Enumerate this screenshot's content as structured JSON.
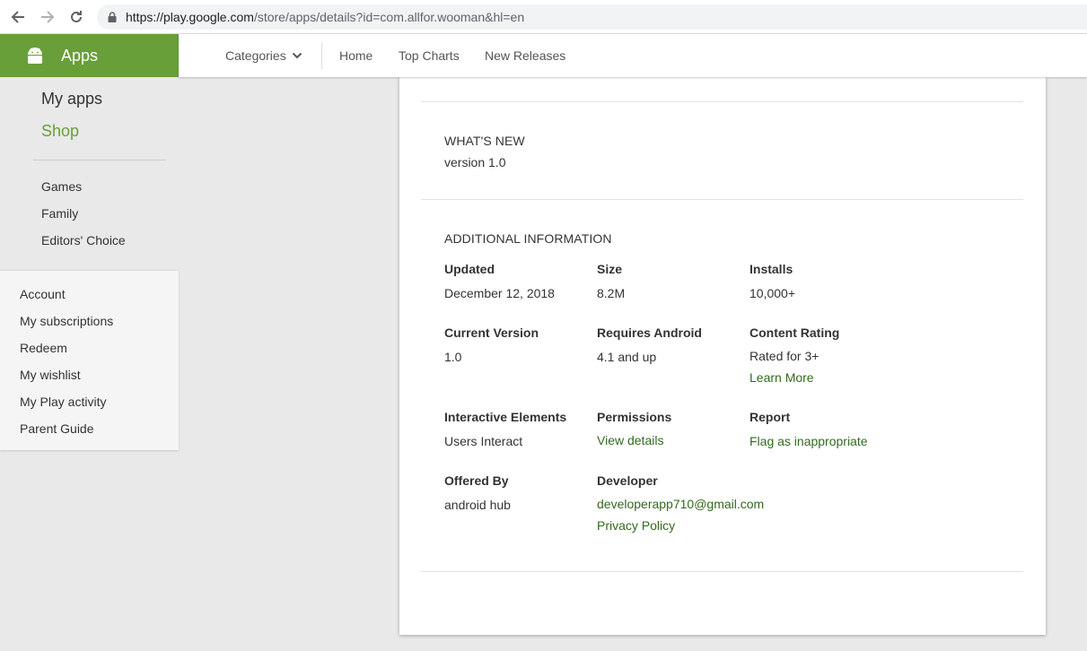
{
  "browser": {
    "url_prefix": "https://play.google.com",
    "url_rest": "/store/apps/details?id=com.allfor.wooman&hl=en"
  },
  "header": {
    "apps_title": "Apps",
    "nav": {
      "categories": "Categories",
      "home": "Home",
      "top_charts": "Top Charts",
      "new_releases": "New Releases"
    }
  },
  "sidebar": {
    "my_apps": "My apps",
    "shop": "Shop",
    "games": "Games",
    "family": "Family",
    "editors_choice": "Editors' Choice",
    "account": "Account",
    "my_subscriptions": "My subscriptions",
    "redeem": "Redeem",
    "my_wishlist": "My wishlist",
    "my_play_activity": "My Play activity",
    "parent_guide": "Parent Guide"
  },
  "whats_new": {
    "heading": "WHAT'S NEW",
    "text": "version 1.0"
  },
  "additional_info": {
    "heading": "ADDITIONAL INFORMATION",
    "updated_label": "Updated",
    "updated_value": "December 12, 2018",
    "size_label": "Size",
    "size_value": "8.2M",
    "installs_label": "Installs",
    "installs_value": "10,000+",
    "current_version_label": "Current Version",
    "current_version_value": "1.0",
    "requires_android_label": "Requires Android",
    "requires_android_value": "4.1 and up",
    "content_rating_label": "Content Rating",
    "content_rating_value": "Rated for 3+",
    "learn_more": "Learn More",
    "interactive_label": "Interactive Elements",
    "interactive_value": "Users Interact",
    "permissions_label": "Permissions",
    "permissions_link": "View details",
    "report_label": "Report",
    "report_link": "Flag as inappropriate",
    "offered_by_label": "Offered By",
    "offered_by_value": "android hub",
    "developer_label": "Developer",
    "developer_email": "developerapp710@gmail.com",
    "privacy_policy": "Privacy Policy"
  },
  "colors": {
    "brand_green": "#689f38",
    "link_green": "#33691e",
    "shop_green": "#689f38"
  }
}
